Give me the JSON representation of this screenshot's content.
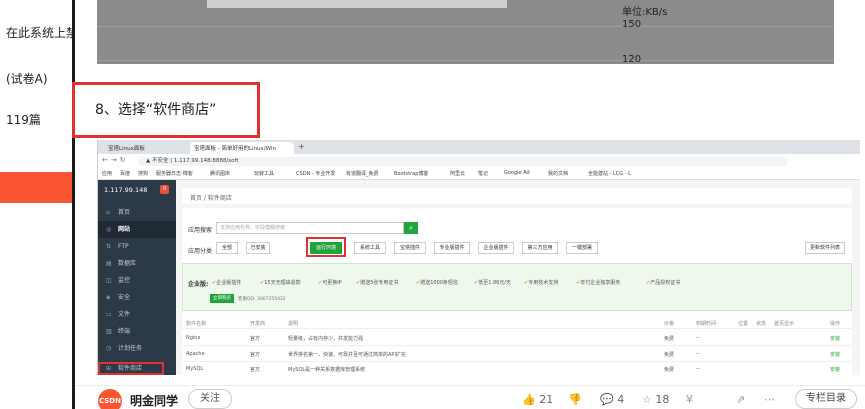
{
  "sidebar": {
    "items": [
      {
        "label": "在此系统上禁"
      },
      {
        "label": "(试卷A)"
      },
      {
        "label": "119篇"
      }
    ]
  },
  "top_chart": {
    "unit_label": "单位:KB/s",
    "tick_150": "150",
    "tick_120": "120"
  },
  "step": {
    "caption": "8、选择“软件商店”"
  },
  "browser": {
    "tab1": "宝塔Linux面板",
    "tab2": "宝塔面板 - 简单好用的Linux/Win",
    "new_tab": "+",
    "url": "▲ 不安全 | 1.117.99.148:8888/soft",
    "bookmarks": [
      "应用",
      "百度",
      "搜狗",
      "服务器日志-博客",
      "腾讯图床",
      "玩转工具",
      "CSDN - 专业开发",
      "有道翻译_免费",
      "Bootstrap博客",
      "阿里云",
      "笔记",
      "Google Ad",
      "我的文档",
      "全能建站 - LCG - L"
    ]
  },
  "bt": {
    "host": "1.117.99.148",
    "badge": "0",
    "menu": [
      {
        "icon": "⌂",
        "label": "首页"
      },
      {
        "icon": "◎",
        "label": "网站"
      },
      {
        "icon": "⇅",
        "label": "FTP"
      },
      {
        "icon": "▤",
        "label": "数据库"
      },
      {
        "icon": "◫",
        "label": "监控"
      },
      {
        "icon": "◈",
        "label": "安全"
      },
      {
        "icon": "▭",
        "label": "文件"
      },
      {
        "icon": "▥",
        "label": "终端"
      },
      {
        "icon": "◷",
        "label": "计划任务"
      },
      {
        "icon": "⊞",
        "label": "软件商店"
      }
    ],
    "breadcrumb": "首页 / 软件商店",
    "search_label": "应用搜索",
    "search_placeholder": "支持应用名称、字段模糊搜索",
    "category_label": "应用分类",
    "categories": [
      "全部",
      "已安装",
      "运行环境",
      "系统工具",
      "宝塔插件",
      "专业版插件",
      "企业版插件",
      "第三方应用",
      "一键部署"
    ],
    "update_label": "更新软件列表",
    "enterprise_title": "企业版:",
    "features": [
      "企业版插件",
      "15天无理由退款",
      "可更换IP",
      "赠送5张专用证书",
      "赠送1000条短信",
      "低至1.86元/天",
      "专用技术支持",
      "年付企业独享服务",
      "产品授权证书"
    ],
    "buy_label": "立即购买",
    "qq_text": "客服QQ: 3007255432",
    "table_headers": [
      "软件名称",
      "开发商",
      "说明",
      "价格",
      "到期时间",
      "位置",
      "状态",
      "首页显示",
      "操作"
    ],
    "rows": [
      {
        "name": "Nginx",
        "dev": "官方",
        "desc": "轻量级，占有内存少，并发能力强",
        "price": "免费",
        "expiry": "--",
        "op": "安装"
      },
      {
        "name": "Apache",
        "dev": "官方",
        "desc": "世界排名第一，快速、可靠并且可通过简单的API扩充",
        "price": "免费",
        "expiry": "--",
        "op": "安装"
      },
      {
        "name": "MySQL",
        "dev": "官方",
        "desc": "MySQL是一种关系数据库管理系统",
        "price": "免费",
        "expiry": "--",
        "op": "安装"
      }
    ]
  },
  "footer": {
    "logo": "CSDN",
    "author": "明金同学",
    "follow": "关注",
    "likes": "21",
    "comments": "4",
    "favorites": "18",
    "column_btn": "专栏目录"
  },
  "colors": {
    "accent": "#fc5531",
    "bt_green": "#20a53a",
    "highlight_red": "#e03131"
  }
}
